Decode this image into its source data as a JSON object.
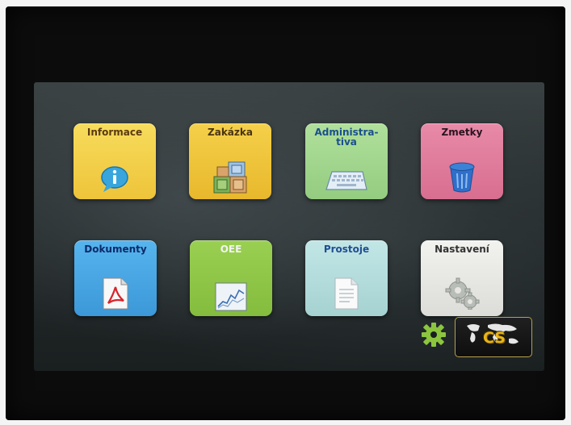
{
  "tiles": [
    {
      "label": "Informace",
      "icon": "info-bubble-icon",
      "bg": "#f3d24a",
      "fg": "#5a3a10"
    },
    {
      "label": "Zakázka",
      "icon": "blocks-icon",
      "bg": "#f0c53a",
      "fg": "#4a3410"
    },
    {
      "label": "Administra-\ntiva",
      "icon": "keyboard-icon",
      "bg": "#a4d890",
      "fg": "#1b4f8c"
    },
    {
      "label": "Zmetky",
      "icon": "trash-bin-icon",
      "bg": "#e07d9c",
      "fg": "#2a1420"
    },
    {
      "label": "Dokumenty",
      "icon": "pdf-document-icon",
      "bg": "#4aa8e6",
      "fg": "#0b2a6a"
    },
    {
      "label": "OEE",
      "icon": "oee-chart-icon",
      "bg": "#8fc64a",
      "fg": "#f2f2f2"
    },
    {
      "label": "Prostoje",
      "icon": "document-lines-icon",
      "bg": "#b6dede",
      "fg": "#1f4f92"
    },
    {
      "label": "Nastavení",
      "icon": "gears-icon",
      "bg": "#e9e9e6",
      "fg": "#333333"
    }
  ],
  "toolbar": {
    "settings_icon": "gear-icon",
    "settings_color": "#8cc63f",
    "language_code": "CS",
    "language_icon": "world-map-icon"
  }
}
